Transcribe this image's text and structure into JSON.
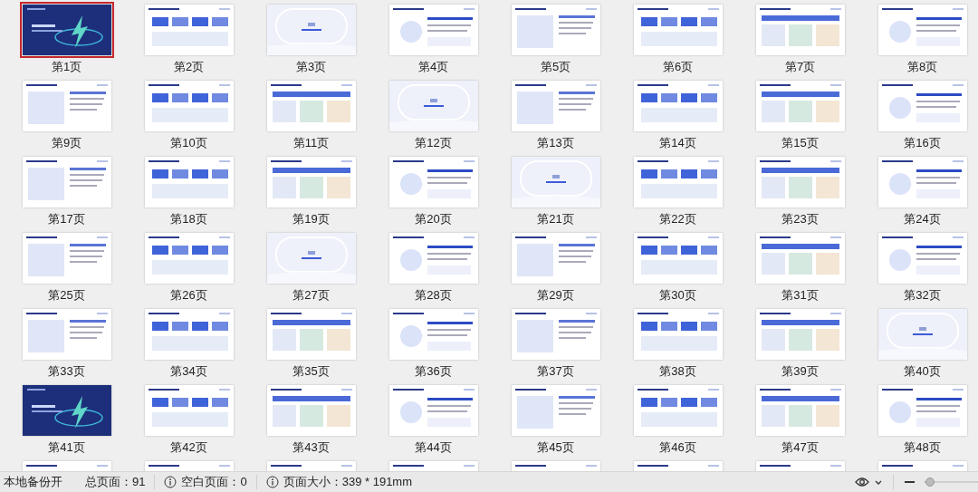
{
  "pages": [
    {
      "label": "第1页",
      "selected": true
    },
    {
      "label": "第2页",
      "selected": false
    },
    {
      "label": "第3页",
      "selected": false
    },
    {
      "label": "第4页",
      "selected": false
    },
    {
      "label": "第5页",
      "selected": false
    },
    {
      "label": "第6页",
      "selected": false
    },
    {
      "label": "第7页",
      "selected": false
    },
    {
      "label": "第8页",
      "selected": false
    },
    {
      "label": "第9页",
      "selected": false
    },
    {
      "label": "第10页",
      "selected": false
    },
    {
      "label": "第11页",
      "selected": false
    },
    {
      "label": "第12页",
      "selected": false
    },
    {
      "label": "第13页",
      "selected": false
    },
    {
      "label": "第14页",
      "selected": false
    },
    {
      "label": "第15页",
      "selected": false
    },
    {
      "label": "第16页",
      "selected": false
    },
    {
      "label": "第17页",
      "selected": false
    },
    {
      "label": "第18页",
      "selected": false
    },
    {
      "label": "第19页",
      "selected": false
    },
    {
      "label": "第20页",
      "selected": false
    },
    {
      "label": "第21页",
      "selected": false
    },
    {
      "label": "第22页",
      "selected": false
    },
    {
      "label": "第23页",
      "selected": false
    },
    {
      "label": "第24页",
      "selected": false
    },
    {
      "label": "第25页",
      "selected": false
    },
    {
      "label": "第26页",
      "selected": false
    },
    {
      "label": "第27页",
      "selected": false
    },
    {
      "label": "第28页",
      "selected": false
    },
    {
      "label": "第29页",
      "selected": false
    },
    {
      "label": "第30页",
      "selected": false
    },
    {
      "label": "第31页",
      "selected": false
    },
    {
      "label": "第32页",
      "selected": false
    },
    {
      "label": "第33页",
      "selected": false
    },
    {
      "label": "第34页",
      "selected": false
    },
    {
      "label": "第35页",
      "selected": false
    },
    {
      "label": "第36页",
      "selected": false
    },
    {
      "label": "第37页",
      "selected": false
    },
    {
      "label": "第38页",
      "selected": false
    },
    {
      "label": "第39页",
      "selected": false
    },
    {
      "label": "第40页",
      "selected": false
    },
    {
      "label": "第41页",
      "selected": false
    },
    {
      "label": "第42页",
      "selected": false
    },
    {
      "label": "第43页",
      "selected": false
    },
    {
      "label": "第44页",
      "selected": false
    },
    {
      "label": "第45页",
      "selected": false
    },
    {
      "label": "第46页",
      "selected": false
    },
    {
      "label": "第47页",
      "selected": false
    },
    {
      "label": "第48页",
      "selected": false
    },
    {
      "selected": false
    },
    {
      "selected": false
    },
    {
      "selected": false
    },
    {
      "selected": false
    },
    {
      "selected": false
    },
    {
      "selected": false
    },
    {
      "selected": false
    },
    {
      "selected": false
    }
  ],
  "status_bar": {
    "backup": "本地备份开",
    "total_pages": "总页面：91",
    "blank_pages": "空白页面：0",
    "page_size": "页面大小：339 * 191mm",
    "zoom": {
      "level": 0.03
    }
  }
}
